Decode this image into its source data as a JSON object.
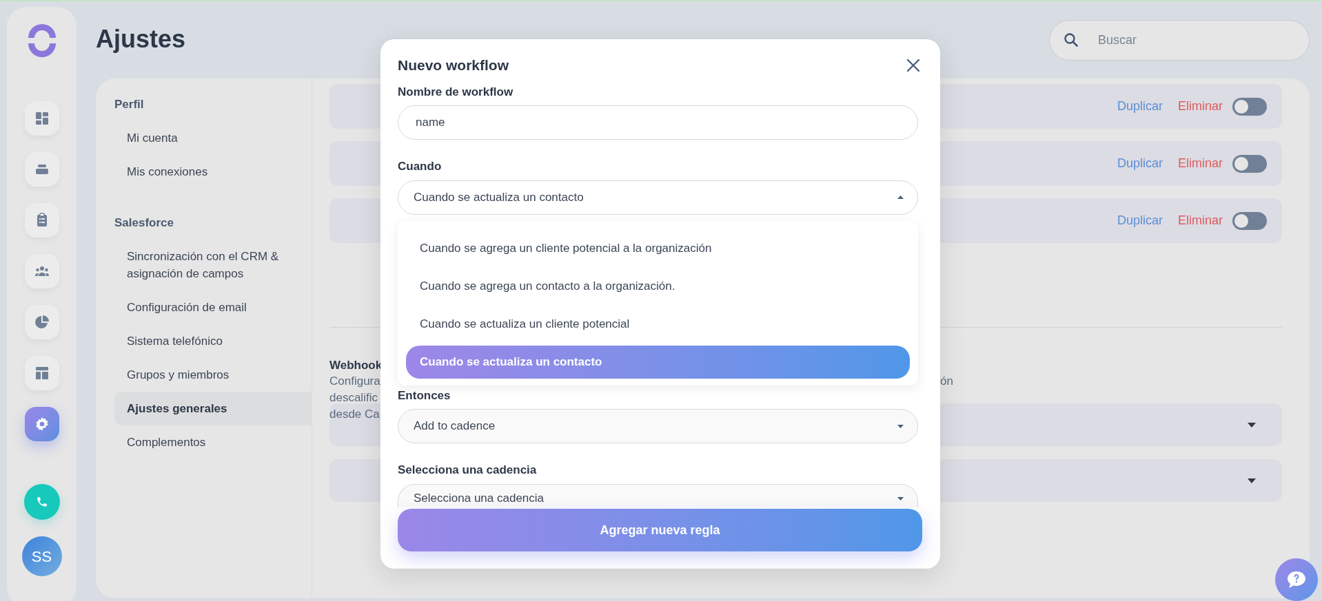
{
  "nav_rail": {
    "items": [
      {
        "kind": "dashboard",
        "selected": false
      },
      {
        "kind": "inbox",
        "selected": false
      },
      {
        "kind": "tasks",
        "selected": false
      },
      {
        "kind": "team",
        "selected": false
      },
      {
        "kind": "reports",
        "selected": false
      },
      {
        "kind": "layout",
        "selected": false
      },
      {
        "kind": "settings",
        "selected": true
      }
    ],
    "avatar": "SS"
  },
  "page_title": "Ajustes",
  "search": {
    "placeholder": "Buscar"
  },
  "settings_menu": {
    "sections": [
      {
        "title": "Perfil",
        "items": [
          {
            "label": "Mi cuenta",
            "selected": false
          },
          {
            "label": "Mis conexiones",
            "selected": false
          }
        ]
      },
      {
        "title": "Salesforce",
        "items": [
          {
            "label": "Sincronización con el CRM & asignación de campos",
            "selected": false
          },
          {
            "label": "Configuración de email",
            "selected": false
          },
          {
            "label": "Sistema telefónico",
            "selected": false
          },
          {
            "label": "Grupos y miembros",
            "selected": false
          },
          {
            "label": "Ajustes generales",
            "selected": true
          },
          {
            "label": "Complementos",
            "selected": false
          }
        ]
      }
    ]
  },
  "workflows": [
    {
      "duplicate": "Duplicar",
      "delete": "Eliminar",
      "on": false
    },
    {
      "duplicate": "Duplicar",
      "delete": "Eliminar",
      "on": false
    },
    {
      "duplicate": "Duplicar",
      "delete": "Eliminar",
      "on": false
    }
  ],
  "webhooks": {
    "title": "Webhook",
    "description_lines": [
      "Configura",
      "descalific",
      "desde Ca"
    ],
    "description_end": "ón",
    "panels": [
      {
        "expanded": false
      },
      {
        "expanded": false
      }
    ]
  },
  "modal": {
    "title": "Nuevo workflow",
    "fields": [
      {
        "kind": "text",
        "label": "Nombre de workflow",
        "value": "name"
      },
      {
        "kind": "select",
        "label": "Cuando",
        "value": "Cuando se actualiza un contacto",
        "expanded": true,
        "options": [
          {
            "label": "Cuando se agrega un cliente potencial a la organización",
            "selected": false
          },
          {
            "label": "Cuando se agrega un contacto a la organización.",
            "selected": false
          },
          {
            "label": "Cuando se actualiza un cliente potencial",
            "selected": false
          },
          {
            "label": "Cuando se actualiza un contacto",
            "selected": true
          }
        ]
      },
      {
        "kind": "select",
        "label": "Entonces",
        "value": "Add to cadence",
        "expanded": false
      },
      {
        "kind": "select",
        "label": "Selecciona una cadencia",
        "placeholder": "Selecciona una cadencia",
        "expanded": false
      }
    ],
    "submit": "Agregar nueva regla"
  }
}
